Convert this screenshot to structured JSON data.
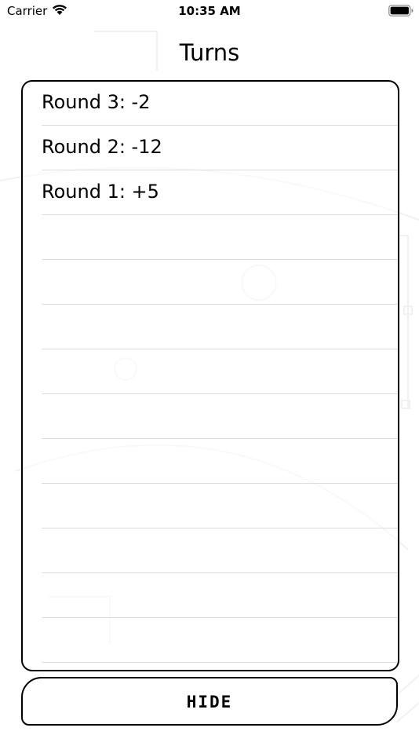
{
  "status_bar": {
    "carrier": "Carrier",
    "time": "10:35 AM",
    "wifi_icon": "wifi-icon",
    "battery_icon": "battery-icon"
  },
  "title": "Turns",
  "turns": [
    {
      "label": "Round 3: -2"
    },
    {
      "label": "Round 2: -12"
    },
    {
      "label": "Round 1: +5"
    },
    {
      "label": ""
    },
    {
      "label": ""
    },
    {
      "label": ""
    },
    {
      "label": ""
    },
    {
      "label": ""
    },
    {
      "label": ""
    },
    {
      "label": ""
    },
    {
      "label": ""
    },
    {
      "label": ""
    },
    {
      "label": ""
    }
  ],
  "hide_button": {
    "label": "HIDE"
  },
  "colors": {
    "border": "#000000",
    "separator": "#dcdcdc",
    "background": "#ffffff"
  }
}
